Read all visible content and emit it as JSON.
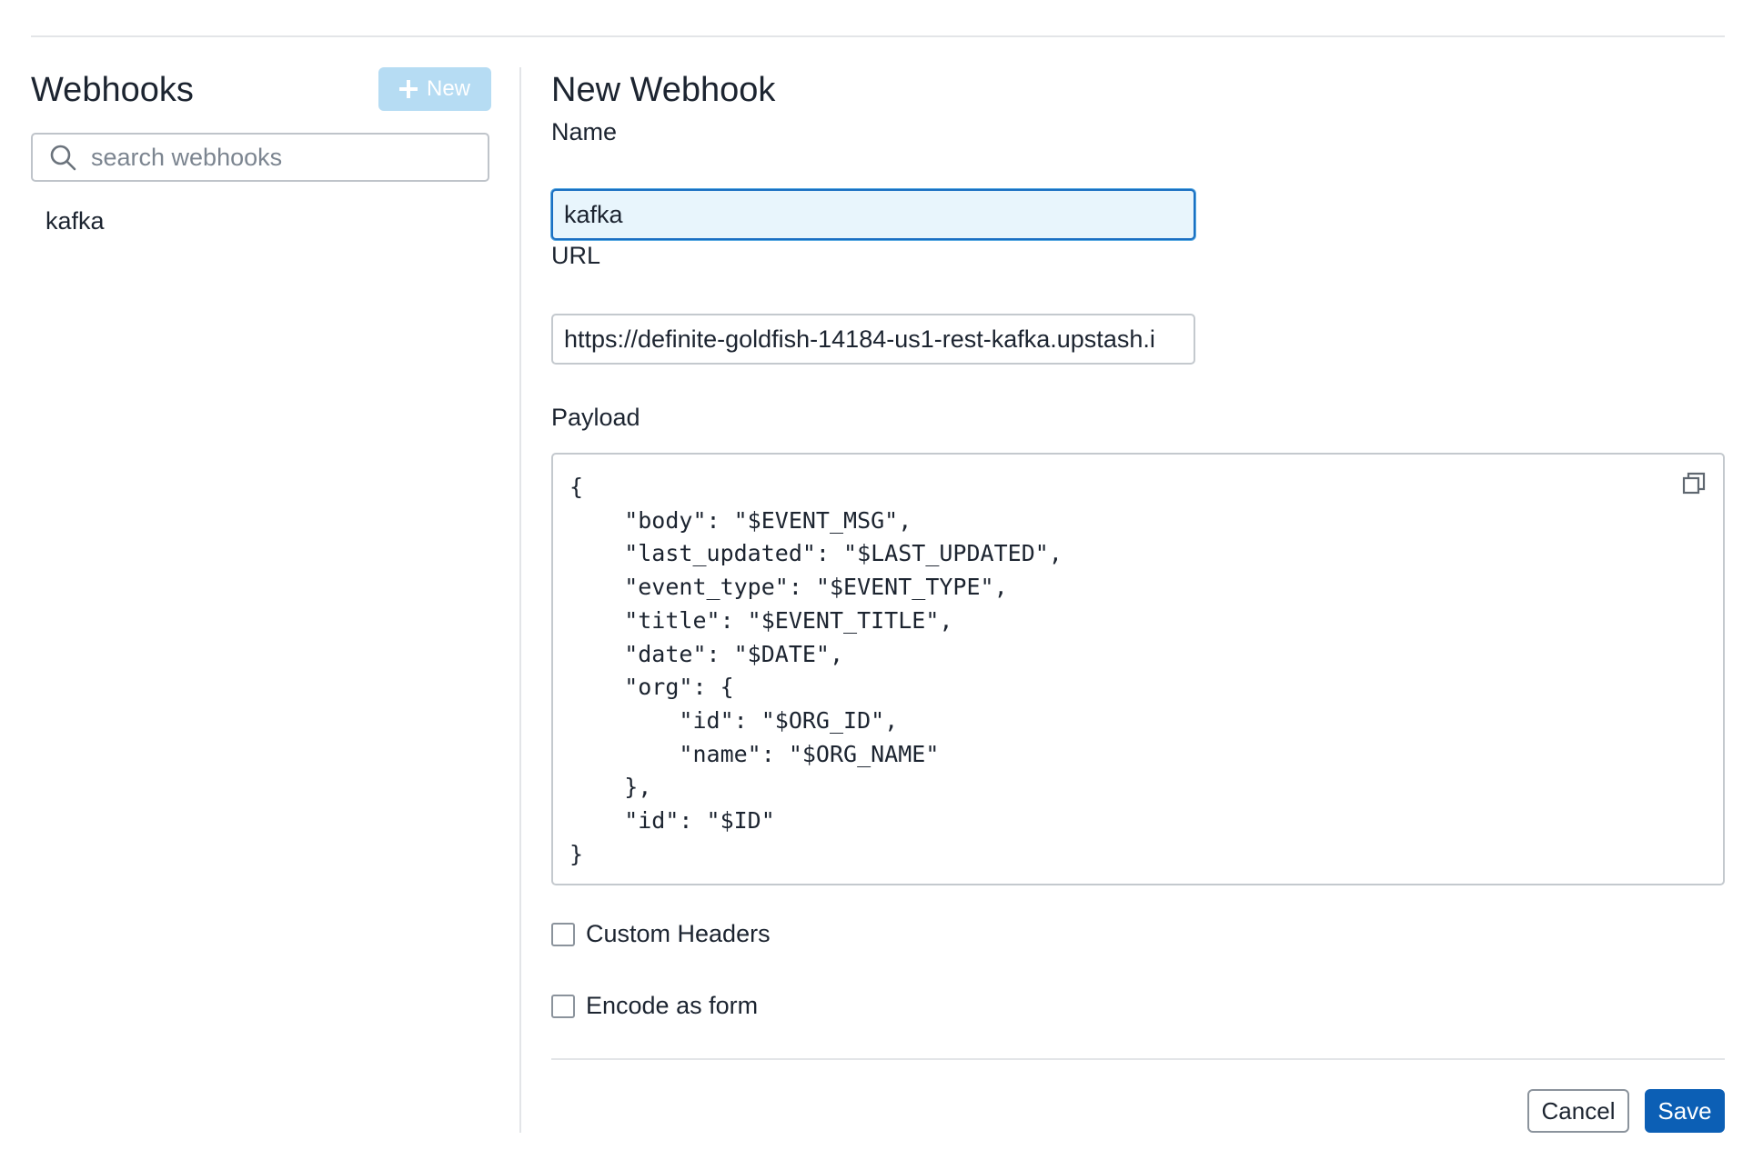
{
  "sidebar": {
    "title": "Webhooks",
    "new_label": "New",
    "search_placeholder": "search webhooks",
    "items": [
      {
        "label": "kafka"
      }
    ]
  },
  "form": {
    "title": "New Webhook",
    "name_label": "Name",
    "name_value": "kafka",
    "url_label": "URL",
    "url_value": "https://definite-goldfish-14184-us1-rest-kafka.upstash.i",
    "payload_label": "Payload",
    "payload": "{\n    \"body\": \"$EVENT_MSG\",\n    \"last_updated\": \"$LAST_UPDATED\",\n    \"event_type\": \"$EVENT_TYPE\",\n    \"title\": \"$EVENT_TITLE\",\n    \"date\": \"$DATE\",\n    \"org\": {\n        \"id\": \"$ORG_ID\",\n        \"name\": \"$ORG_NAME\"\n    },\n    \"id\": \"$ID\"\n}",
    "custom_headers_label": "Custom Headers",
    "encode_form_label": "Encode as form",
    "cancel_label": "Cancel",
    "save_label": "Save"
  },
  "icons": {
    "new": "plus-icon",
    "search": "search-icon",
    "copy": "copy-icon"
  },
  "colors": {
    "primary": "#0c5fb5",
    "new_button_disabled": "#b6dcf3",
    "focus_border": "#1a6fc2",
    "focus_fill": "#e8f5fc"
  }
}
